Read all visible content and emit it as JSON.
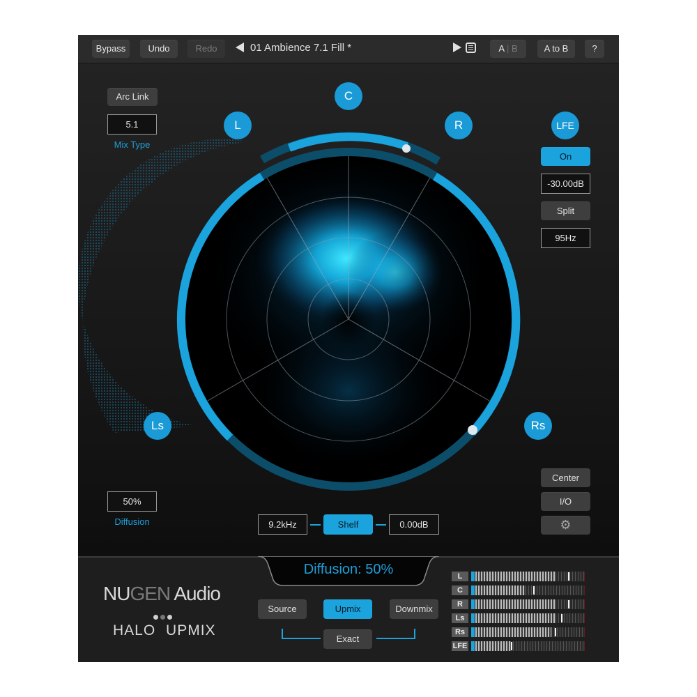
{
  "toolbar": {
    "bypass": "Bypass",
    "undo": "Undo",
    "redo": "Redo",
    "preset_name": "01 Ambience 7.1 Fill *",
    "ab_a": "A",
    "ab_sep": "|",
    "ab_b": "B",
    "a_to_b": "A to B",
    "help": "?"
  },
  "left_panel": {
    "arc_link": "Arc Link",
    "mix_type_value": "5.1",
    "mix_type_label": "Mix Type",
    "diffusion_value": "50%",
    "diffusion_label": "Diffusion"
  },
  "speakers": {
    "L": "L",
    "C": "C",
    "R": "R",
    "Ls": "Ls",
    "Rs": "Rs",
    "LFE": "LFE"
  },
  "lfe_panel": {
    "on": "On",
    "gain": "-30.00dB",
    "split": "Split",
    "freq": "95Hz"
  },
  "right_buttons": {
    "center": "Center",
    "io": "I/O",
    "settings_icon": "gear-icon"
  },
  "shelf": {
    "freq": "9.2kHz",
    "mode": "Shelf",
    "gain": "0.00dB"
  },
  "status": {
    "readout": "Diffusion: 50%"
  },
  "brand": {
    "nu": "NU",
    "gen": "GEN",
    "audio": "Audio",
    "product_a": "HALO",
    "product_b": "UPMIX"
  },
  "modes": {
    "source": "Source",
    "upmix": "Upmix",
    "downmix": "Downmix",
    "exact": "Exact"
  },
  "colors": {
    "accent": "#1aa3dc",
    "accent_dark": "#0c4e6a",
    "background": "#1c1c1c"
  },
  "meters": [
    {
      "label": "L",
      "level": 0.74,
      "peak": 0.85
    },
    {
      "label": "C",
      "level": 0.46,
      "peak": 0.53
    },
    {
      "label": "R",
      "level": 0.74,
      "peak": 0.85
    },
    {
      "label": "Ls",
      "level": 0.74,
      "peak": 0.79
    },
    {
      "label": "Rs",
      "level": 0.7,
      "peak": 0.73
    },
    {
      "label": "LFE",
      "level": 0.32,
      "peak": 0.33
    }
  ]
}
